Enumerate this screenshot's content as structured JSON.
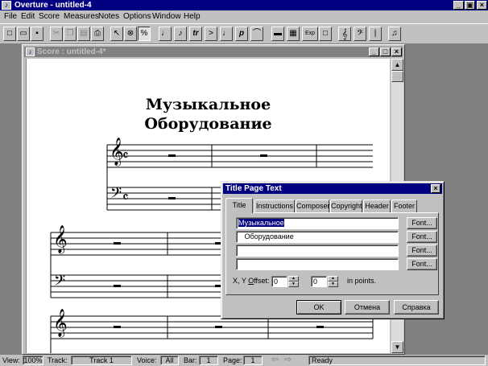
{
  "app": {
    "title": "Overture - untitled-4",
    "icon_glyph": "♪",
    "minimize_glyph": "_",
    "restore_glyph": "▣",
    "close_glyph": "×"
  },
  "menu": [
    "File",
    "Edit",
    "Score",
    "Measures",
    "Notes",
    "Options",
    "Window",
    "Help"
  ],
  "toolbar": {
    "icons": [
      {
        "name": "new-icon",
        "glyph": "□"
      },
      {
        "name": "open-icon",
        "glyph": "▭"
      },
      {
        "name": "save-icon",
        "glyph": "▪"
      },
      {
        "name": "cut-icon",
        "glyph": "✂"
      },
      {
        "name": "copy-icon",
        "glyph": "❐"
      },
      {
        "name": "paste-icon",
        "glyph": "▤"
      },
      {
        "name": "print-icon",
        "glyph": "⎙"
      },
      {
        "name": "arrow-tool-icon",
        "glyph": "↖"
      },
      {
        "name": "erase-tool-icon",
        "glyph": "⊗"
      },
      {
        "name": "percent-tool-icon",
        "glyph": "%"
      },
      {
        "name": "quarter-note-icon",
        "glyph": "♩"
      },
      {
        "name": "grace-note-icon",
        "glyph": "♪"
      },
      {
        "name": "trill-icon",
        "glyph": "tr"
      },
      {
        "name": "accent-icon",
        "glyph": ">"
      },
      {
        "name": "note-head-icon",
        "glyph": "♩"
      },
      {
        "name": "dynamic-p-icon",
        "glyph": "p"
      },
      {
        "name": "slur-icon",
        "glyph": "⌒"
      },
      {
        "name": "beam-icon",
        "glyph": "▬"
      },
      {
        "name": "text-box-icon",
        "glyph": "▦"
      },
      {
        "name": "expression-icon",
        "glyph": "Exp"
      },
      {
        "name": "frame-icon",
        "glyph": "□"
      },
      {
        "name": "treble-clef-tool-icon",
        "glyph": "𝄞"
      },
      {
        "name": "bass-clef-tool-icon",
        "glyph": "𝄢"
      },
      {
        "name": "barline-icon",
        "glyph": "|"
      },
      {
        "name": "play-note-icon",
        "glyph": "♫"
      }
    ]
  },
  "score_window": {
    "title": "Score : untitled-4*",
    "icon_glyph": "♪",
    "minimize_glyph": "_",
    "maximize_glyph": "□",
    "close_glyph": "×",
    "title_line1": "Музыкальное",
    "title_line2": "Оборудование",
    "scroll_up_glyph": "▲",
    "scroll_down_glyph": "▼",
    "treble_clef": "𝄞",
    "bass_clef": "𝄢",
    "time_signature": "𝄴",
    "whole_rest": "▬"
  },
  "dialog": {
    "title": "Title Page Text",
    "close_glyph": "×",
    "tabs": [
      "Title",
      "Instructions",
      "Composer",
      "Copyright",
      "Header",
      "Footer"
    ],
    "active_tab": "Title",
    "lines": [
      {
        "text": "Музыкальное",
        "selected": true
      },
      {
        "text": "   Оборудование",
        "selected": false
      },
      {
        "text": "",
        "selected": false
      },
      {
        "text": "",
        "selected": false
      }
    ],
    "font_button_label": "Font...",
    "offset_label_prefix": "X, Y ",
    "offset_label_underlined": "O",
    "offset_label_suffix": "ffset:",
    "x_offset": "0",
    "y_offset": "0",
    "units_label": "in points.",
    "ok_label": "OK",
    "cancel_label": "Отмена",
    "help_label": "Справка"
  },
  "statusbar": {
    "view_label": "View:",
    "zoom": "100%",
    "track_label": "Track:",
    "track_value": "Track 1",
    "voice_label": "Voice:",
    "voice_value": "All",
    "bar_label": "Bar:",
    "bar_value": "1",
    "page_label": "Page:",
    "page_value": "1",
    "prev_glyph": "⇦",
    "next_glyph": "⇨",
    "status": "Ready"
  }
}
